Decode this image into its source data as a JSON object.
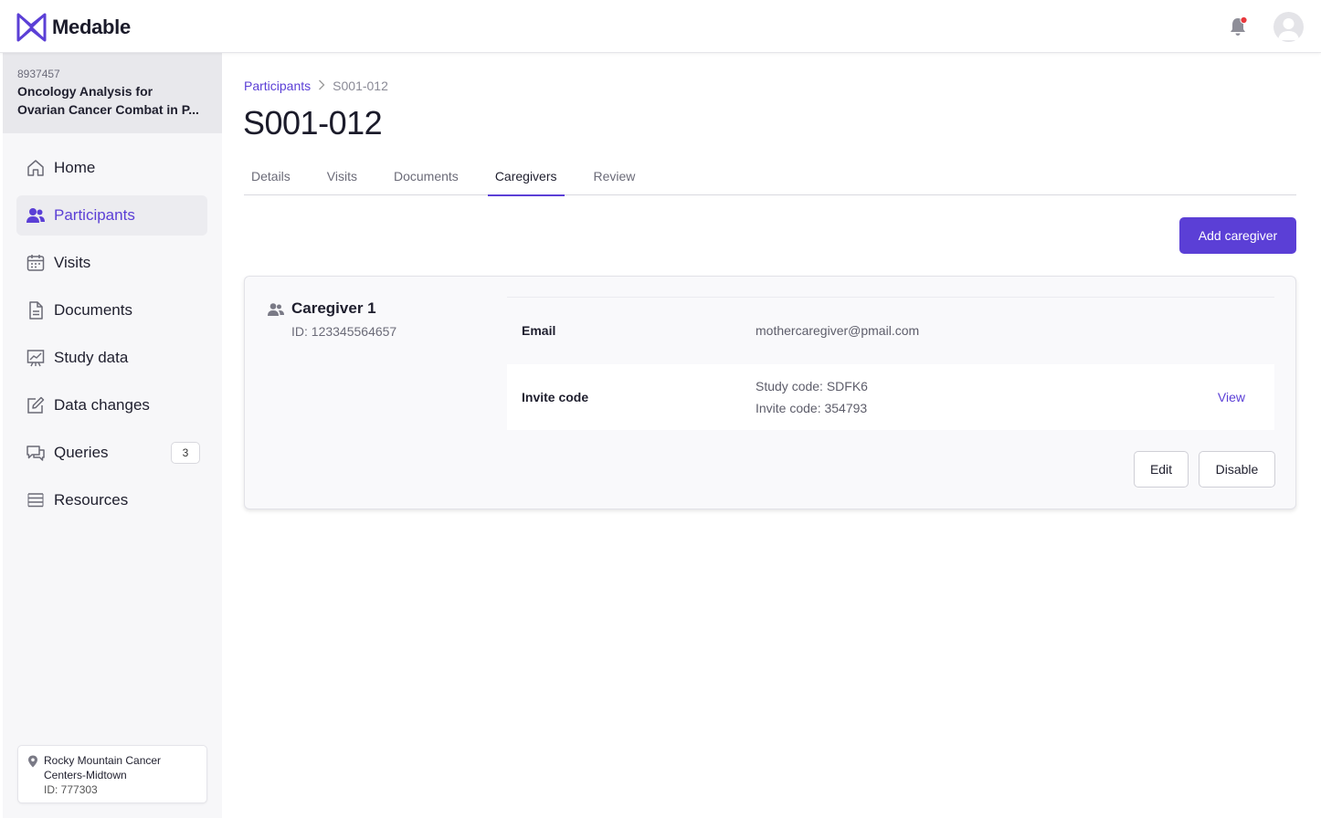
{
  "app": {
    "brand": "Medable",
    "accent": "#5b3fd6",
    "notification_dot": "#e8383d"
  },
  "topbar": {
    "bell_icon": "bell-icon",
    "avatar_icon": "user-avatar-icon"
  },
  "study": {
    "id": "8937457",
    "name_line1": "Oncology Analysis for",
    "name_line2": "Ovarian Cancer Combat in P..."
  },
  "sidebar": {
    "items": [
      {
        "label": "Home",
        "icon": "home-icon"
      },
      {
        "label": "Participants",
        "icon": "users-icon",
        "active": true
      },
      {
        "label": "Visits",
        "icon": "calendar-icon"
      },
      {
        "label": "Documents",
        "icon": "document-icon"
      },
      {
        "label": "Study data",
        "icon": "chart-icon"
      },
      {
        "label": "Data changes",
        "icon": "edit-icon"
      },
      {
        "label": "Queries",
        "icon": "chat-icon",
        "badge": "3"
      },
      {
        "label": "Resources",
        "icon": "list-icon"
      }
    ],
    "site": {
      "name_line1": "Rocky Mountain Cancer",
      "name_line2": "Centers-Midtown",
      "id": "ID: 777303"
    }
  },
  "breadcrumb": {
    "parent": "Participants",
    "current": "S001-012"
  },
  "page": {
    "title": "S001-012"
  },
  "tabs": [
    {
      "label": "Details"
    },
    {
      "label": "Visits"
    },
    {
      "label": "Documents"
    },
    {
      "label": "Caregivers",
      "active": true
    },
    {
      "label": "Review"
    }
  ],
  "actions": {
    "add_caregiver": "Add caregiver"
  },
  "caregiver": {
    "name": "Caregiver 1",
    "id": "ID: 123345564657",
    "email_label": "Email",
    "email_value": "mothercaregiver@pmail.com",
    "invite_label": "Invite code",
    "study_code": "Study code: SDFK6",
    "invite_code": "Invite code: 354793",
    "view_label": "View",
    "edit_label": "Edit",
    "disable_label": "Disable"
  }
}
